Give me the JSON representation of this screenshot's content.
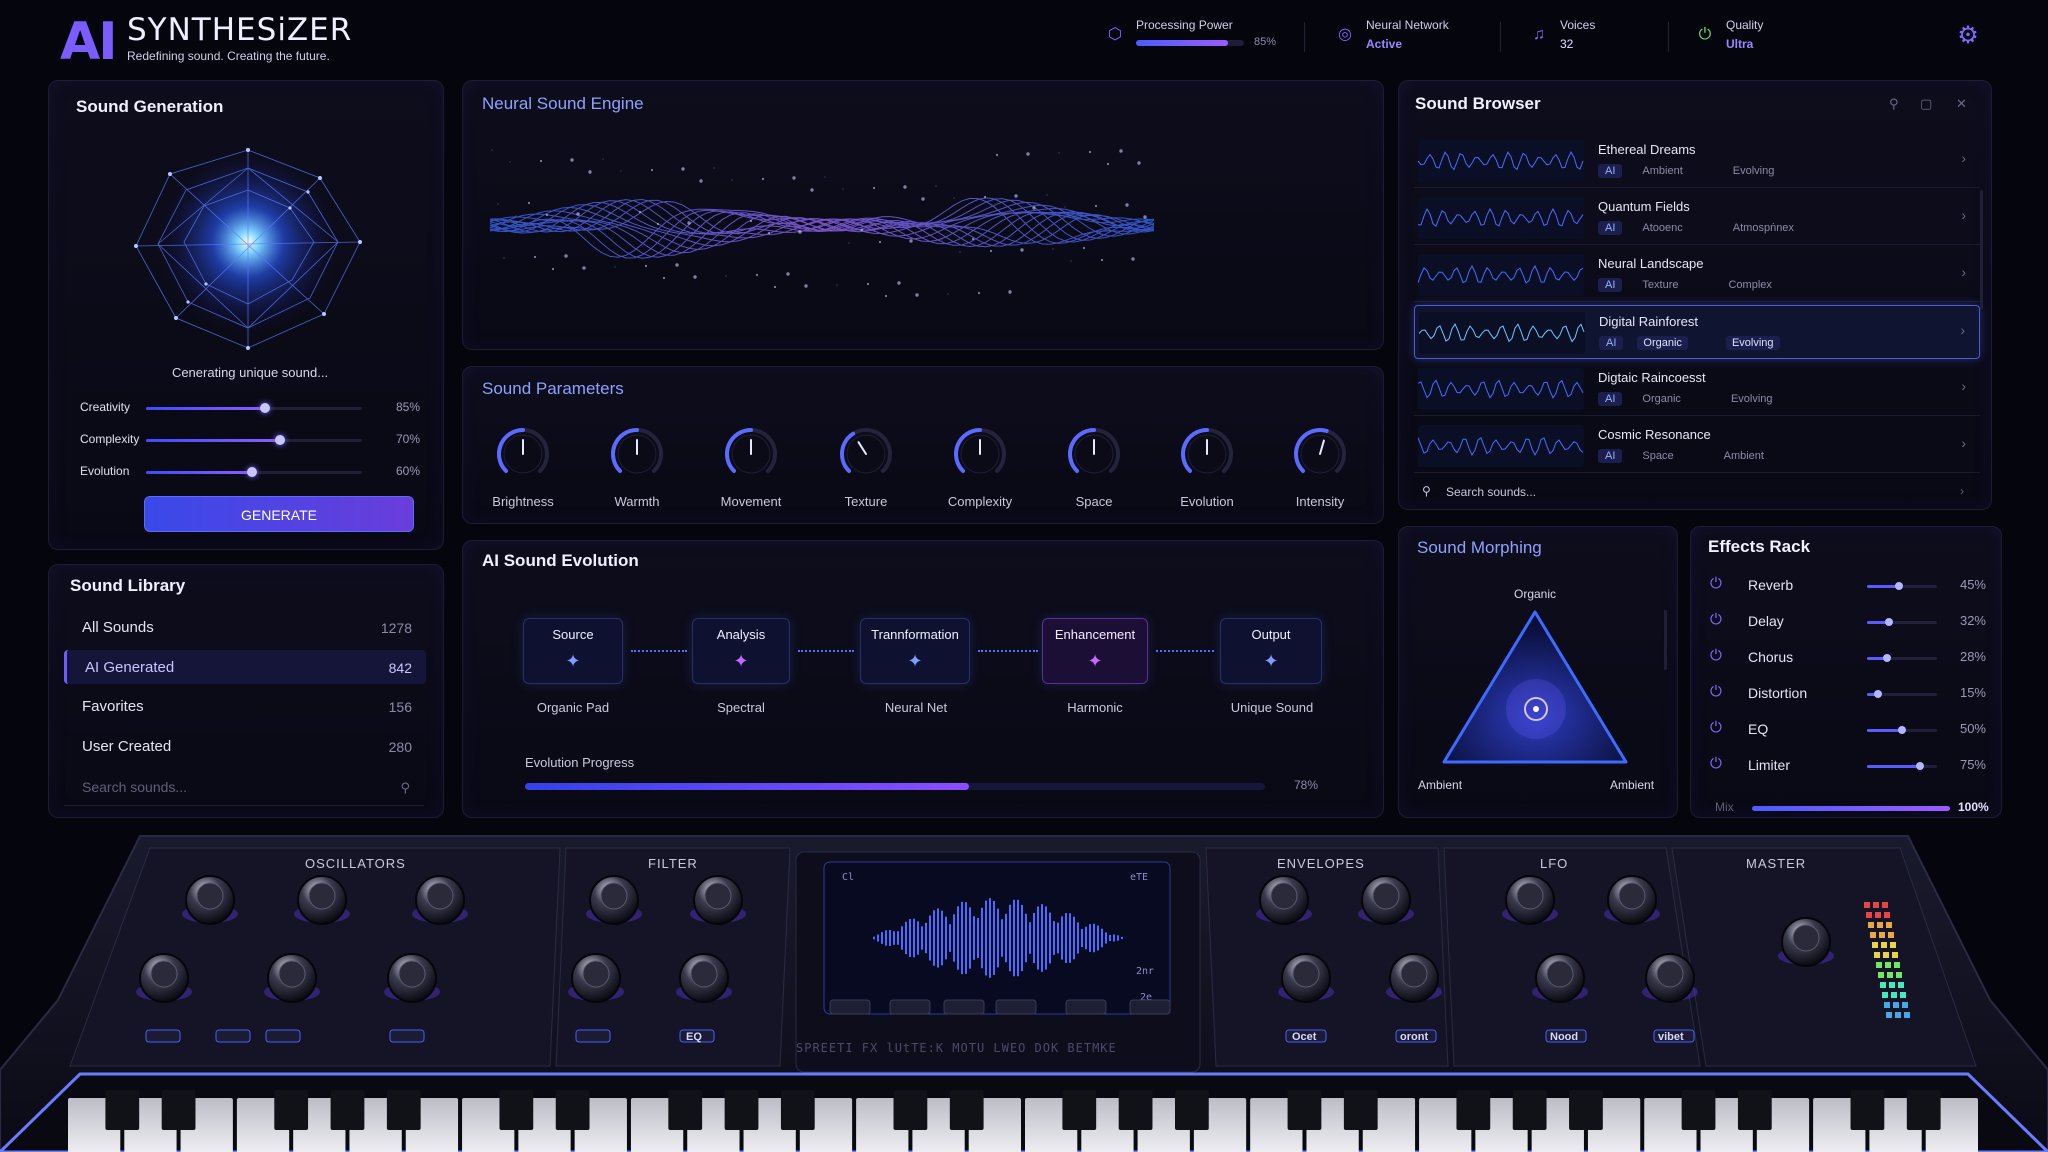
{
  "header": {
    "logo_ai": "AI",
    "logo_name": "SYNTHESiZER",
    "tagline": "Redefining sound. Creating the future.",
    "processing_power": {
      "label": "Processing Power",
      "value": "85%",
      "level": 0.85
    },
    "neural_network": {
      "label": "Neural Network",
      "value": "Active"
    },
    "voices": {
      "label": "Voices",
      "value": "32"
    },
    "quality": {
      "label": "Quality",
      "value": "Ultra"
    },
    "settings_icon": "gear-icon"
  },
  "sound_generation": {
    "title": "Sound Generation",
    "status": "Cenerating unique sound...",
    "sliders": [
      {
        "label": "Creativity",
        "value": "85%",
        "level": 0.55
      },
      {
        "label": "Complexity",
        "value": "70%",
        "level": 0.62
      },
      {
        "label": "Evolution",
        "value": "60%",
        "level": 0.49
      }
    ],
    "button": "GENERATE"
  },
  "sound_library": {
    "title": "Sound Library",
    "items": [
      {
        "name": "All Sounds",
        "count": "1278"
      },
      {
        "name": "AI Generated",
        "count": "842"
      },
      {
        "name": "Favorites",
        "count": "156"
      },
      {
        "name": "User Created",
        "count": "280"
      }
    ],
    "search_placeholder": "Search sounds..."
  },
  "neural_engine": {
    "title": "Neural Sound Engine"
  },
  "sound_parameters": {
    "title": "Sound Parameters",
    "knobs": [
      {
        "label": "Brightness",
        "level": 0.5
      },
      {
        "label": "Warmth",
        "level": 0.5
      },
      {
        "label": "Movement",
        "level": 0.5
      },
      {
        "label": "Texture",
        "level": 0.38
      },
      {
        "label": "Complexity",
        "level": 0.5
      },
      {
        "label": "Space",
        "level": 0.5
      },
      {
        "label": "Evolution",
        "level": 0.5
      },
      {
        "label": "Intensity",
        "level": 0.56
      }
    ]
  },
  "ai_evolution": {
    "title": "AI Sound Evolution",
    "nodes": [
      {
        "title": "Source",
        "sub": "Organic Pad"
      },
      {
        "title": "Analysis",
        "sub": "Spectral"
      },
      {
        "title": "Trannformation",
        "sub": "Neural Net"
      },
      {
        "title": "Enhancement",
        "sub": "Harmonic"
      },
      {
        "title": "Output",
        "sub": "Unique Sound"
      }
    ],
    "progress_label": "Evolution Progress",
    "progress_value": "78%",
    "progress_level": 0.6
  },
  "sound_browser": {
    "title": "Sound Browser",
    "items": [
      {
        "name": "Ethereal Dreams",
        "tags": [
          "AI",
          "Ambient",
          "Evolving"
        ]
      },
      {
        "name": "Quantum Fields",
        "tags": [
          "AI",
          "Atooenc",
          "Atmospṅnex"
        ]
      },
      {
        "name": "Neural Landscape",
        "tags": [
          "AI",
          "Texture",
          "Complex"
        ]
      },
      {
        "name": "Digital Rainforest",
        "tags": [
          "AI",
          "Organic",
          "Evolving"
        ]
      },
      {
        "name": "Digtaic Raincoesst",
        "tags": [
          "AI",
          "Organic",
          "Evolving"
        ]
      },
      {
        "name": "Cosmic Resonance",
        "tags": [
          "AI",
          "Space",
          "Ambient"
        ]
      }
    ],
    "search_placeholder": "Search sounds..."
  },
  "sound_morphing": {
    "title": "Sound Morphing",
    "top": "Organic",
    "bottom_left": "Ambient",
    "bottom_right": "Ambient"
  },
  "effects_rack": {
    "title": "Effects Rack",
    "items": [
      {
        "name": "Reverb",
        "value": "45%",
        "level": 0.45
      },
      {
        "name": "Delay",
        "value": "32%",
        "level": 0.32
      },
      {
        "name": "Chorus",
        "value": "28%",
        "level": 0.28
      },
      {
        "name": "Distortion",
        "value": "15%",
        "level": 0.15
      },
      {
        "name": "EQ",
        "value": "50%",
        "level": 0.5
      },
      {
        "name": "Limiter",
        "value": "75%",
        "level": 0.75
      }
    ],
    "mix_label": "Mix",
    "mix_value": "100%",
    "mix_level": 1.0
  },
  "hardware": {
    "sections": [
      "OSCILLATORS",
      "FILTER",
      "ENVELOPES",
      "LFO",
      "MASTER"
    ],
    "osc_buttons": [
      "",
      "",
      "",
      ""
    ],
    "filter_button": "EQ",
    "screen_menu": "SPREEТI   FX   lUtTE:K   MOTU   LWEO   DOK   BETMKE",
    "env_buttons": [
      "Ocet",
      "oront"
    ],
    "lfo_buttons": [
      "Nood",
      "vibet"
    ],
    "screen_labels": [
      "Cl",
      "eTE",
      "2nr",
      "2e"
    ]
  },
  "colors": {
    "accent": "#7a5cff",
    "blue": "#4b5cff",
    "green": "#5ee07a",
    "bg": "#05050d"
  }
}
